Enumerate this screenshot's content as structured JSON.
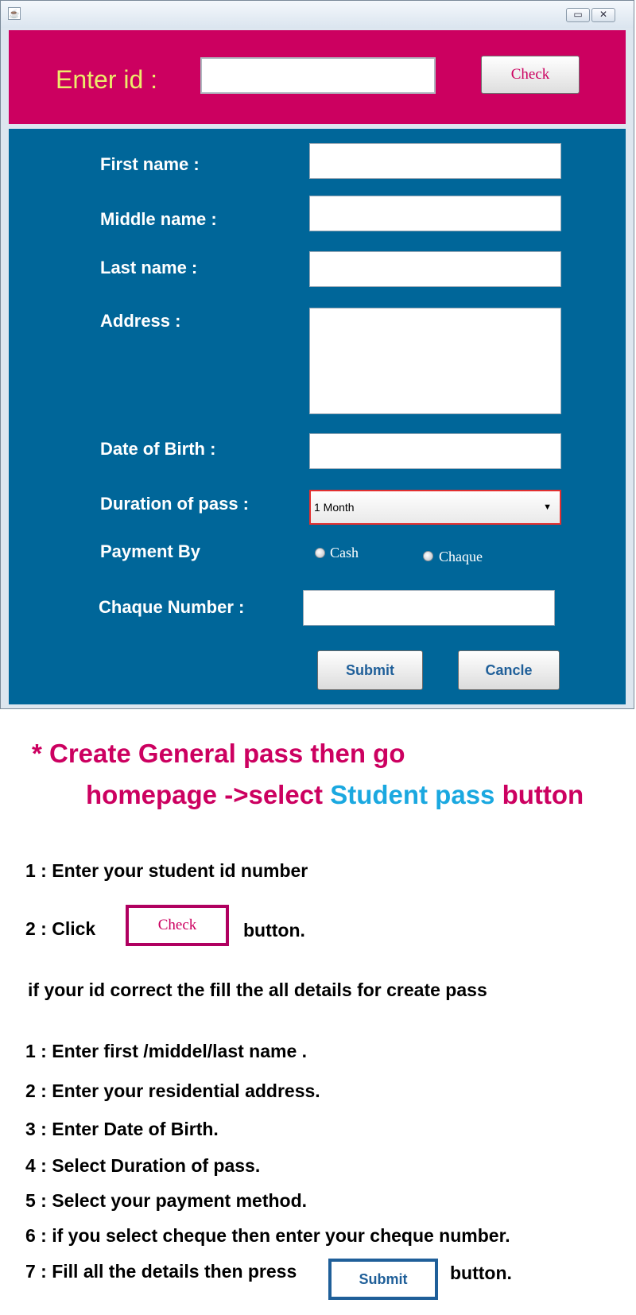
{
  "window": {
    "icon": "java-cup-icon",
    "min_glyph": "▭",
    "close_glyph": "✕"
  },
  "id_panel": {
    "label": "Enter id :",
    "input_value": "",
    "check_label": "Check"
  },
  "form": {
    "first_name": "First name :",
    "middle_name": "Middle name :",
    "last_name": "Last name :",
    "address": "Address :",
    "dob": "Date of Birth :",
    "duration": "Duration of pass :",
    "duration_value": "1 Month",
    "payment_by": "Payment By",
    "cash": "Cash",
    "chaque": "Chaque",
    "chaque_number": "Chaque Number :",
    "submit": "Submit",
    "cancel": "Cancle"
  },
  "instructions": {
    "heading_line1": "* Create General pass then go",
    "heading_line2_a": "homepage ->select",
    "heading_line2_b": "Student pass",
    "heading_line2_c": "button",
    "step1": "1 :  Enter your student id number",
    "step2_a": "2 : Click",
    "step2_button": "Check",
    "step2_b": "button.",
    "note": "if your id correct the fill the all details for create pass",
    "list": [
      "1 : Enter first /middel/last name .",
      "2 :  Enter your residential address.",
      "3 : Enter Date of Birth.",
      "4 : Select Duration of pass.",
      "5 : Select your payment method.",
      "6 : if you select cheque then enter your cheque number."
    ],
    "step7_a": "7 : Fill all the details then press",
    "step7_button": "Submit",
    "step7_b": "button."
  },
  "colors": {
    "magenta": "#cc0060",
    "form_blue": "#006699",
    "label_yellow": "#ecec6a",
    "accent_blue": "#1aa8e0"
  }
}
